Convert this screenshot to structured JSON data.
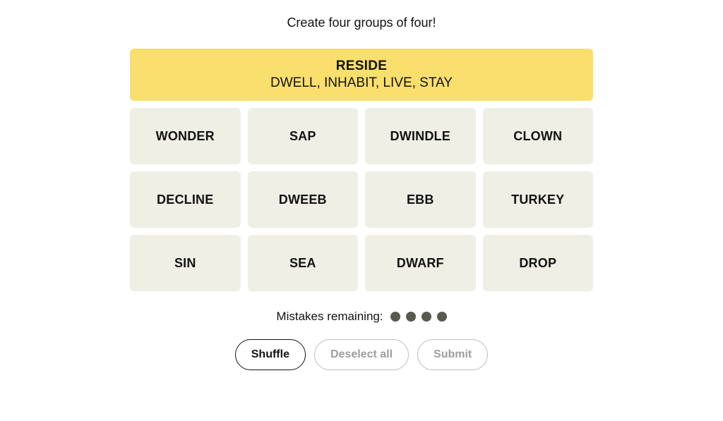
{
  "instructions": "Create four groups of four!",
  "solved": {
    "title": "RESIDE",
    "words": "DWELL, INHABIT, LIVE, STAY"
  },
  "tiles": [
    "WONDER",
    "SAP",
    "DWINDLE",
    "CLOWN",
    "DECLINE",
    "DWEEB",
    "EBB",
    "TURKEY",
    "SIN",
    "SEA",
    "DWARF",
    "DROP"
  ],
  "mistakes": {
    "label": "Mistakes remaining:",
    "remaining": 4
  },
  "buttons": {
    "shuffle": "Shuffle",
    "deselect": "Deselect all",
    "submit": "Submit"
  }
}
